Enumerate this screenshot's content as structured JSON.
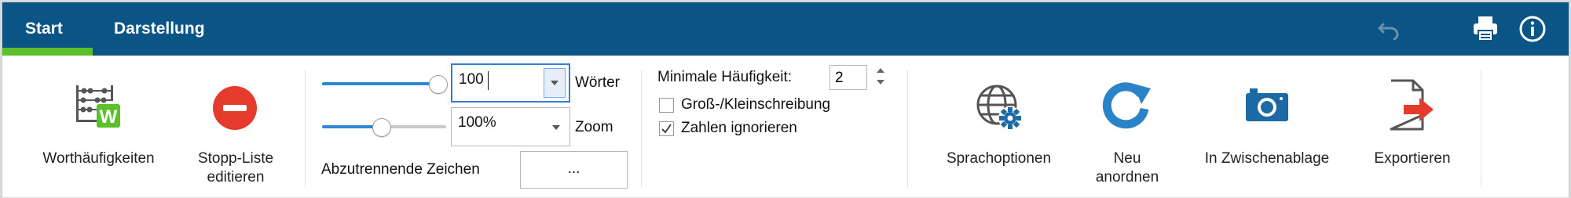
{
  "tabs": [
    {
      "label": "Start",
      "active": true
    },
    {
      "label": "Darstellung",
      "active": false
    }
  ],
  "topbar_icons": [
    "undo-icon",
    "printer-icon",
    "info-icon"
  ],
  "colors": {
    "topbar": "#0b5486",
    "active_tab_underline": "#5cc02a",
    "accent_blue": "#2d87d4",
    "stop_red": "#e53b2c",
    "export_red": "#e53b2c",
    "word_green": "#5cc02a"
  },
  "ribbon": {
    "word_frequency": {
      "label": "Worthäufigkeiten",
      "icon": "abacus-word-icon"
    },
    "stop_list": {
      "label_line1": "Stopp-Liste",
      "label_line2": "editieren",
      "icon": "stop-icon"
    },
    "words_slider": {
      "value": 100,
      "max": 100
    },
    "words_combo": {
      "value": "100",
      "unit_label": "Wörter"
    },
    "zoom_slider": {
      "value_percent": 100
    },
    "zoom_combo": {
      "value": "100%",
      "unit_label": "Zoom"
    },
    "separators": {
      "label": "Abzutrennende Zeichen",
      "button": "..."
    },
    "min_frequency": {
      "label": "Minimale Häufigkeit:",
      "value": "2"
    },
    "case_sensitive": {
      "label": "Groß-/Kleinschreibung",
      "checked": false
    },
    "ignore_numbers": {
      "label": "Zahlen ignorieren",
      "checked": true
    },
    "language_options": {
      "label": "Sprachoptionen",
      "icon": "globe-gear-icon"
    },
    "rearrange": {
      "label_line1": "Neu",
      "label_line2": "anordnen",
      "icon": "refresh-icon"
    },
    "clipboard": {
      "label": "In Zwischenablage",
      "icon": "camera-icon"
    },
    "export": {
      "label": "Exportieren",
      "icon": "export-icon"
    }
  }
}
